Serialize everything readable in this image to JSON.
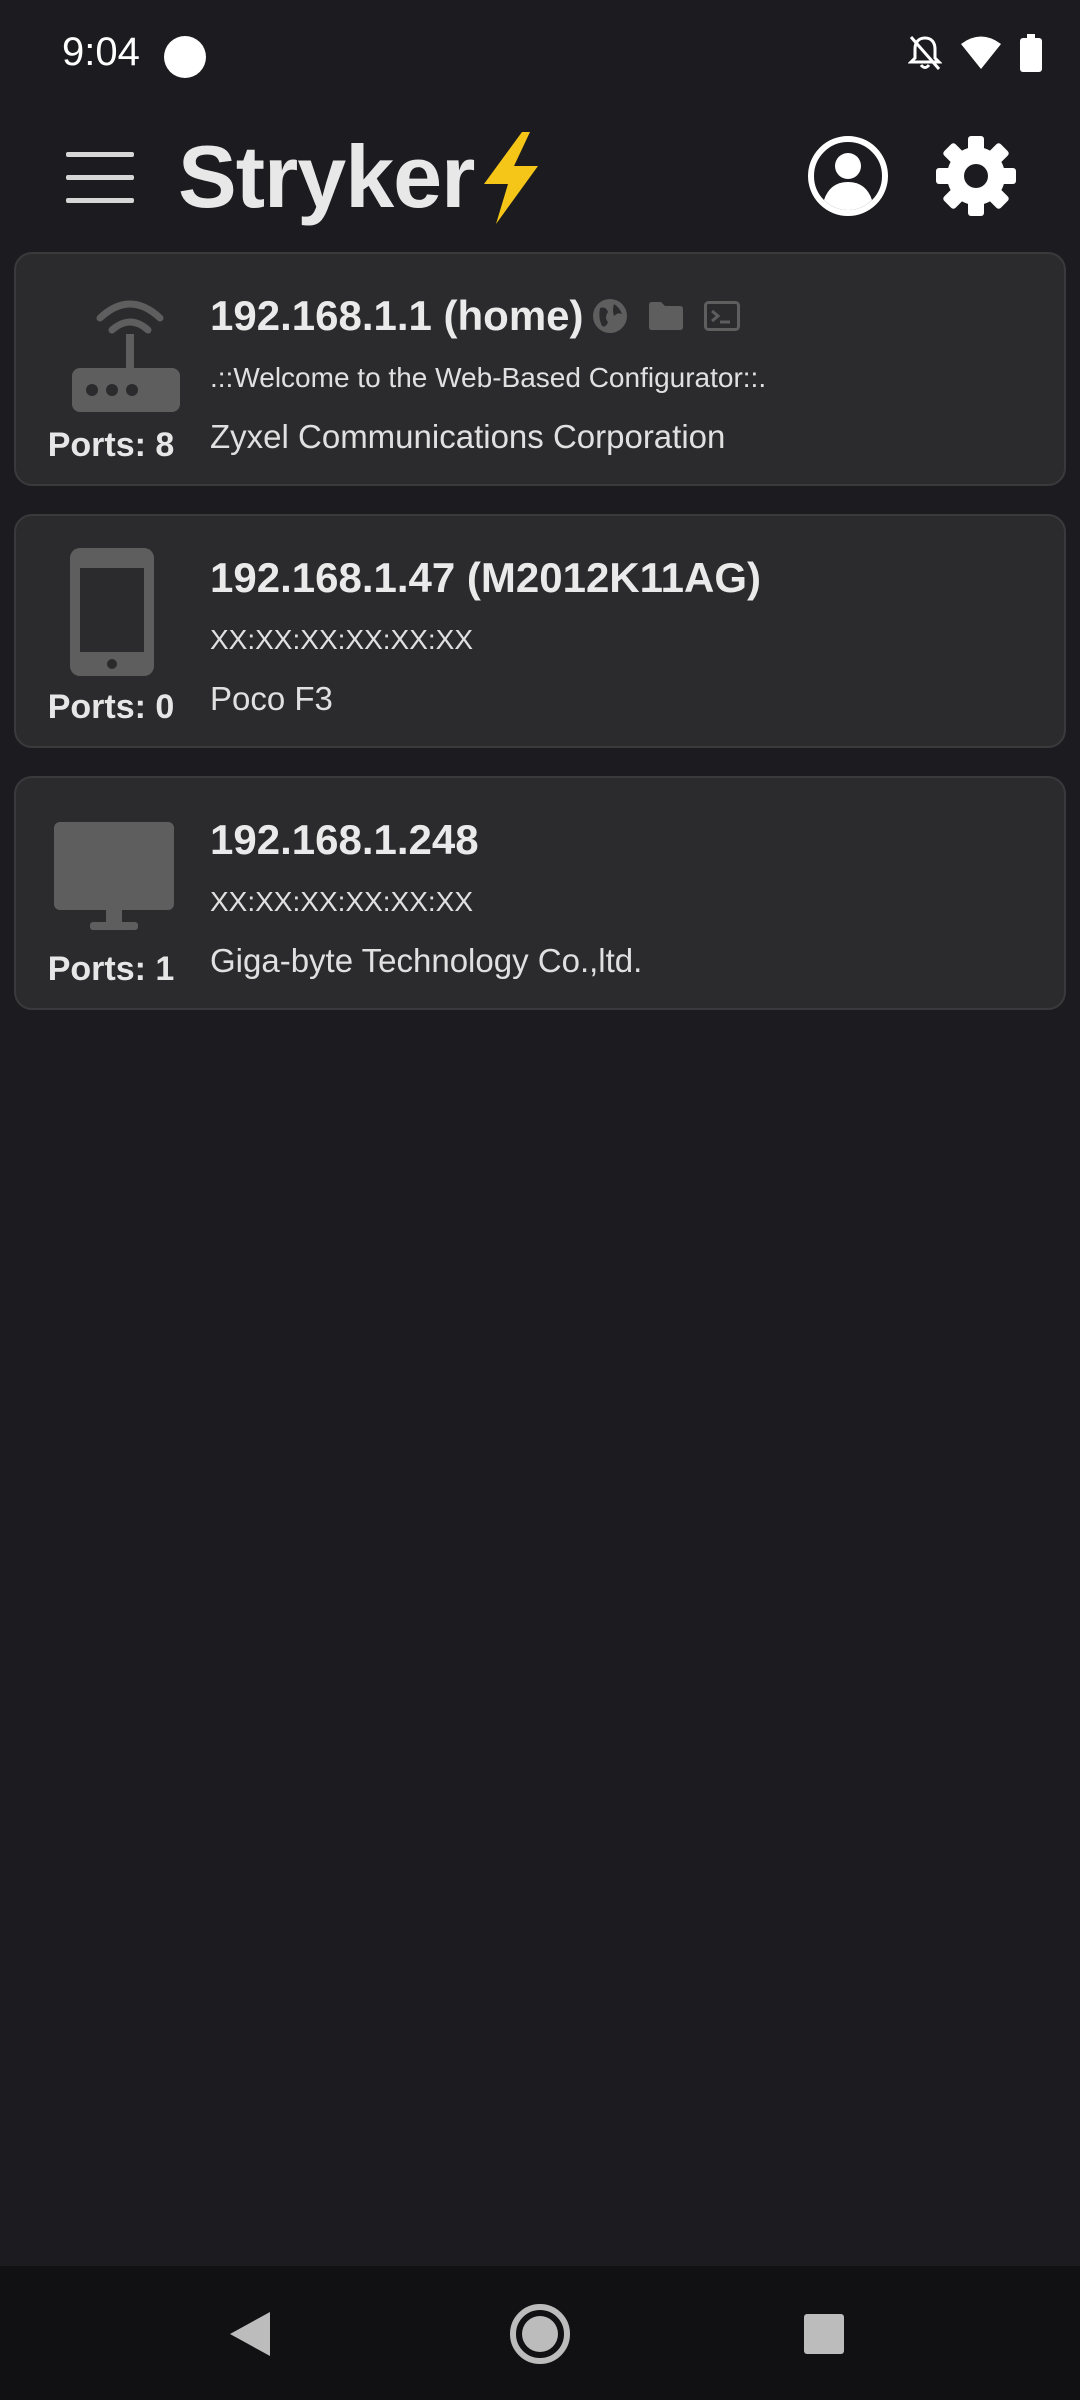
{
  "status_bar": {
    "time": "9:04",
    "icons": [
      "notifications-off-icon",
      "wifi-icon",
      "battery-icon"
    ]
  },
  "app_bar": {
    "title": "Stryker",
    "emoji_icon": "lightning-bolt-icon",
    "actions": [
      "account-circle-icon",
      "settings-gear-icon"
    ]
  },
  "devices": [
    {
      "title": "192.168.1.1 (home)",
      "line2": ".::Welcome to the Web-Based Configurator::.",
      "line3": "Zyxel Communications Corporation",
      "ports": "Ports: 8",
      "icon": "router-icon",
      "services": [
        "web-globe-icon",
        "folder-icon",
        "terminal-icon"
      ]
    },
    {
      "title": "192.168.1.47 (M2012K11AG)",
      "line2": "XX:XX:XX:XX:XX:XX",
      "line3": "Poco F3",
      "ports": "Ports: 0",
      "icon": "phone-icon",
      "services": []
    },
    {
      "title": "192.168.1.248",
      "line2": "XX:XX:XX:XX:XX:XX",
      "line3": "Giga-byte Technology Co.,ltd.",
      "ports": "Ports: 1",
      "icon": "desktop-monitor-icon",
      "services": []
    }
  ],
  "colors": {
    "background": "#1c1c20",
    "card": "#2b2b2d",
    "icon_gray": "#5e5e5e",
    "bolt": "#f5c518"
  }
}
